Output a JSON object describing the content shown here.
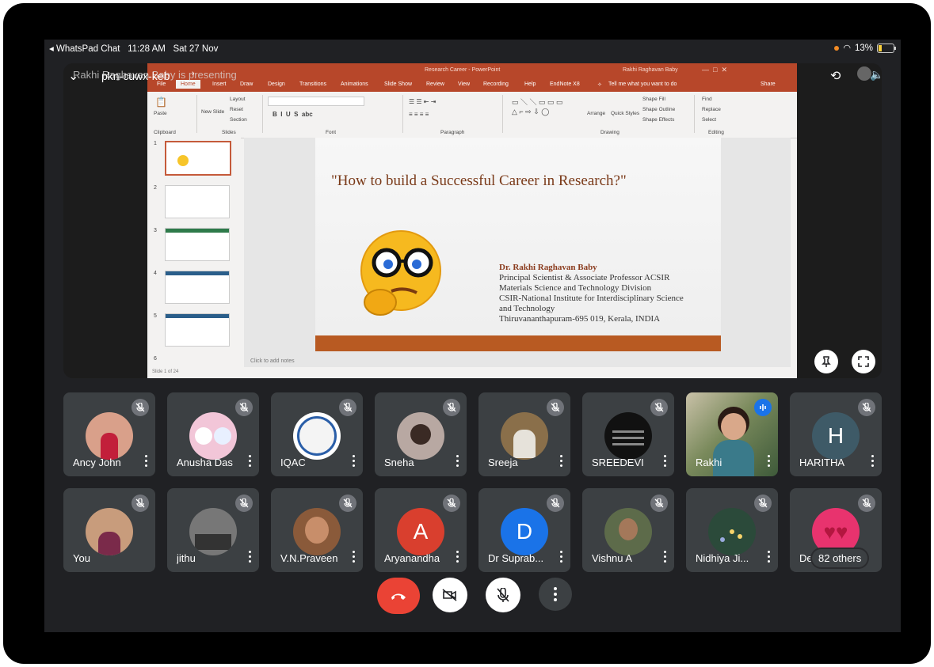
{
  "status_bar": {
    "app_back": "◂ WhatsPad Chat",
    "time": "11:28 AM",
    "date": "Sat 27 Nov",
    "battery_text": "13%"
  },
  "meeting": {
    "code": "pkn-cuwx-keb",
    "presenter_caption": "Rakhi Raghavan Baby is presenting"
  },
  "powerpoint": {
    "window_title": "Research Career - PowerPoint",
    "user": "Rakhi Raghavan Baby",
    "tabs": [
      "File",
      "Home",
      "Insert",
      "Draw",
      "Design",
      "Transitions",
      "Animations",
      "Slide Show",
      "Review",
      "View",
      "Recording",
      "Help",
      "EndNote X8"
    ],
    "tell_me": "Tell me what you want to do",
    "share": "Share",
    "ribbon": {
      "paste": "Paste",
      "new_slide": "New Slide",
      "layout": "Layout",
      "reset": "Reset",
      "section": "Section",
      "clipboard": "Clipboard",
      "slides": "Slides",
      "font": "Font",
      "paragraph": "Paragraph",
      "drawing": "Drawing",
      "editing": "Editing",
      "arrange": "Arrange",
      "quick_styles": "Quick Styles",
      "shape_fill": "Shape Fill",
      "shape_outline": "Shape Outline",
      "shape_effects": "Shape Effects",
      "find": "Find",
      "replace": "Replace",
      "select": "Select"
    },
    "slide_numbers": [
      "1",
      "2",
      "3",
      "4",
      "5",
      "6"
    ],
    "notes_placeholder": "Click to add notes",
    "status_text": "Slide 1 of 24",
    "slide": {
      "title": "\"How to build a Successful Career in Research?\"",
      "author_name": "Dr. Rakhi Raghavan Baby",
      "author_lines": [
        "Principal Scientist & Associate Professor ACSIR",
        "Materials Science and Technology Division",
        "CSIR-National Institute for Interdisciplinary Science",
        "and Technology",
        "Thiruvananthapuram-695 019, Kerala, INDIA"
      ]
    }
  },
  "participants_row1": [
    {
      "name": "Ancy John",
      "avatar": "photo",
      "color": "#d9a08a"
    },
    {
      "name": "Anusha Das",
      "avatar": "photo",
      "color": "#f2c6d8"
    },
    {
      "name": "IQAC",
      "avatar": "logo",
      "color": "#ffffff"
    },
    {
      "name": "Sneha",
      "avatar": "photo",
      "color": "#b8a8a2"
    },
    {
      "name": "Sreeja",
      "avatar": "photo",
      "color": "#8a6f4a"
    },
    {
      "name": "SREEDEVI",
      "avatar": "quote",
      "color": "#111111"
    },
    {
      "name": "Rakhi",
      "avatar": "video",
      "color": "#6b7a4c"
    },
    {
      "name": "HARITHA",
      "avatar": "letter",
      "letter": "H",
      "color": "#3e5a67"
    }
  ],
  "participants_row2": [
    {
      "name": "You",
      "avatar": "photo",
      "color": "#c89c7c"
    },
    {
      "name": "jithu",
      "avatar": "photo",
      "color": "#777777"
    },
    {
      "name": "V.N.Praveen",
      "avatar": "photo",
      "color": "#8a5a3a"
    },
    {
      "name": "Aryanandha",
      "avatar": "letter",
      "letter": "A",
      "color": "#d93f2e"
    },
    {
      "name": "Dr Suprab...",
      "avatar": "letter",
      "letter": "D",
      "color": "#1a73e8"
    },
    {
      "name": "Vishnu A",
      "avatar": "photo",
      "color": "#5d6b4a"
    },
    {
      "name": "Nidhiya Ji...",
      "avatar": "photo",
      "color": "#2b4a3a"
    },
    {
      "name": "De",
      "avatar": "photo",
      "color": "#e8336e",
      "overflow": "82 others"
    }
  ],
  "controls": {
    "end_call_color": "#ea4335",
    "accent": "#1a73e8"
  }
}
